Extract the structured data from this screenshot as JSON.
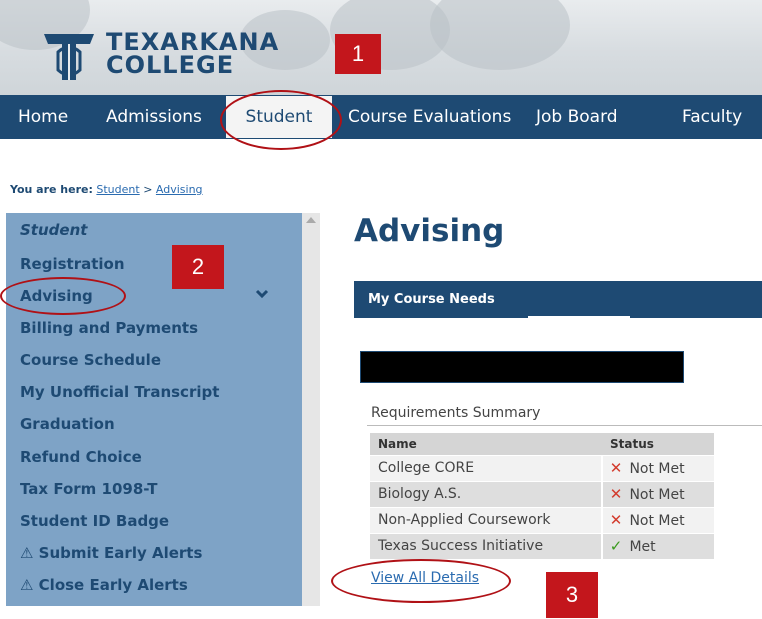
{
  "header": {
    "logo_line1": "TEXARKANA",
    "logo_line2": "COLLEGE",
    "callout_1": "1"
  },
  "nav": {
    "items": [
      "Home",
      "Admissions",
      "Student",
      "Course Evaluations",
      "Job Board",
      "Faculty"
    ],
    "active": "Student"
  },
  "breadcrumb": {
    "label": "You are here:",
    "crumb_1": "Student",
    "separator": ">",
    "crumb_2": "Advising"
  },
  "sidebar": {
    "title": "Student",
    "items": [
      "Registration",
      "Advising",
      "Billing and Payments",
      "Course Schedule",
      "My Unofficial Transcript",
      "Graduation",
      "Refund Choice",
      "Tax Form 1098-T",
      "Student ID Badge",
      "⚠ Submit Early Alerts",
      "⚠ Close Early Alerts"
    ],
    "callout_2": "2"
  },
  "main": {
    "title": "Advising",
    "section_title": "My Course Needs",
    "summary_label": "Requirements Summary",
    "table": {
      "headers": [
        "Name",
        "Status"
      ],
      "rows": [
        {
          "name": "College CORE",
          "status": "Not Met",
          "icon": "x-icon"
        },
        {
          "name": "Biology A.S.",
          "status": "Not Met",
          "icon": "x-icon"
        },
        {
          "name": "Non-Applied Coursework",
          "status": "Not Met",
          "icon": "x-icon"
        },
        {
          "name": "Texas Success Initiative",
          "status": "Met",
          "icon": "check-icon"
        }
      ]
    },
    "view_all": "View All Details",
    "callout_3": "3"
  },
  "colors": {
    "brand_navy": "#1e4a73",
    "sidebar_blue": "#7ea3c6",
    "callout_red": "#c3161c",
    "not_met_red": "#d33c2e",
    "met_green": "#3a9a1e"
  }
}
